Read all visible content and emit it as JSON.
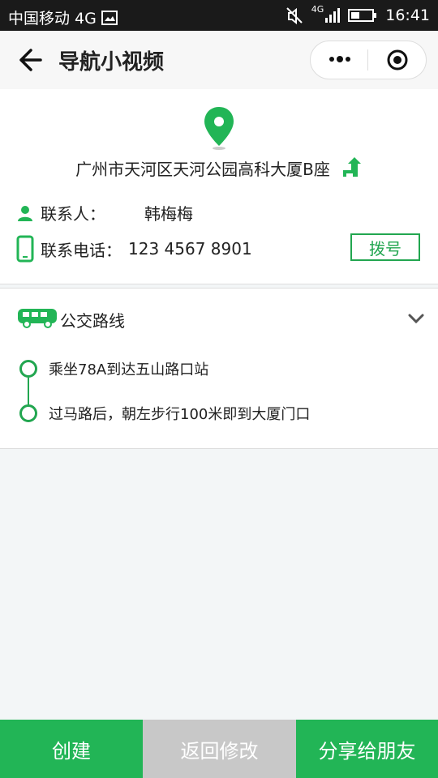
{
  "status_bar": {
    "carrier": "中国移动 4G",
    "network": "4G",
    "time": "16:41"
  },
  "navbar": {
    "title": "导航小视频"
  },
  "location": {
    "address": "广州市天河区天河公园高科大厦B座"
  },
  "contact": {
    "name_label": "联系人：",
    "name_value": "韩梅梅",
    "phone_label": "联系电话：",
    "phone_value": "123 4567 8901",
    "dial_label": "拨号"
  },
  "route": {
    "title": "公交路线",
    "steps": [
      "乘坐78A到达五山路口站",
      "过马路后，朝左步行100米即到大厦门口"
    ]
  },
  "actions": {
    "create": "创建",
    "back_edit": "返回修改",
    "share": "分享给朋友"
  },
  "colors": {
    "accent": "#22b556",
    "accent_dark": "#22a650",
    "disabled": "#c8c8c8"
  },
  "icons": [
    "back-arrow-icon",
    "more-icon",
    "target-icon",
    "location-pin-icon",
    "navigate-arrow-icon",
    "person-icon",
    "phone-icon",
    "bus-icon",
    "chevron-down-icon"
  ]
}
